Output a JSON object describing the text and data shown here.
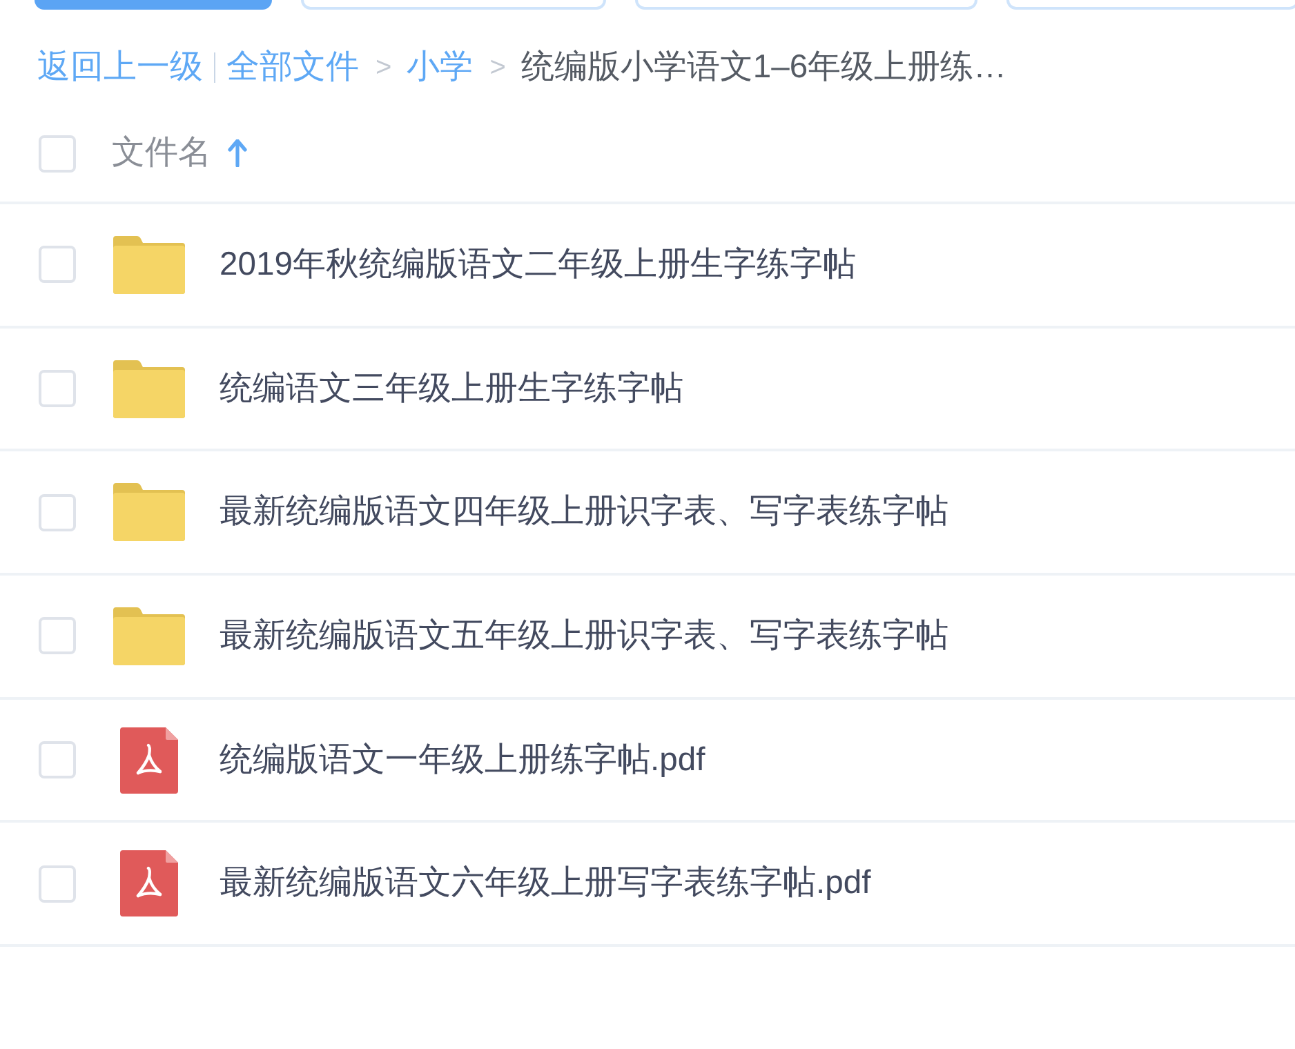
{
  "toolbar_buttons": [
    {
      "kind": "primary"
    },
    {
      "kind": "outline"
    },
    {
      "kind": "outline"
    },
    {
      "kind": "outline"
    }
  ],
  "breadcrumb": [
    {
      "kind": "back",
      "text": "返回上一级"
    },
    {
      "kind": "link",
      "text": "全部文件"
    },
    {
      "kind": "separator",
      "text": ">"
    },
    {
      "kind": "link",
      "text": "小学"
    },
    {
      "kind": "separator",
      "text": ">"
    },
    {
      "kind": "current",
      "text": "统编版小学语文1–6年级上册练…"
    }
  ],
  "header": {
    "checked": false,
    "label": "文件名",
    "ascending": true
  },
  "files": [
    {
      "name": "2019年秋统编版语文二年级上册生字练字帖",
      "kind": "folder",
      "checked": false
    },
    {
      "name": "统编语文三年级上册生字练字帖",
      "kind": "folder",
      "checked": false
    },
    {
      "name": "最新统编版语文四年级上册识字表、写字表练字帖",
      "kind": "folder",
      "checked": false
    },
    {
      "name": "最新统编版语文五年级上册识字表、写字表练字帖",
      "kind": "folder",
      "checked": false
    },
    {
      "name": "统编版语文一年级上册练字帖.pdf",
      "kind": "pdf",
      "checked": false
    },
    {
      "name": "最新统编版语文六年级上册写字表练字帖.pdf",
      "kind": "pdf",
      "checked": false
    }
  ]
}
